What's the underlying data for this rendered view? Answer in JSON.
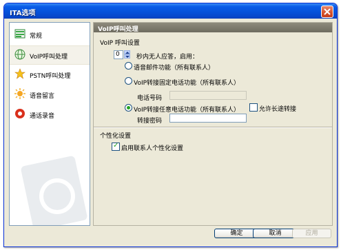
{
  "window": {
    "title": "ITA选项"
  },
  "sidebar": {
    "items": [
      {
        "label": "常规",
        "icon": "general-settings-icon",
        "selected": false
      },
      {
        "label": "VoIP呼叫处理",
        "icon": "voip-globe-icon",
        "selected": true
      },
      {
        "label": "PSTN呼叫处理",
        "icon": "pstn-star-icon",
        "selected": false
      },
      {
        "label": "语音留言",
        "icon": "voicemail-sun-icon",
        "selected": false
      },
      {
        "label": "通话录音",
        "icon": "record-icon",
        "selected": false
      }
    ]
  },
  "panel": {
    "header": "VoIP呼叫处理",
    "voip_section": {
      "title": "VoIP 呼叫设置",
      "seconds_value": "0",
      "seconds_text": "秒内无人应答，启用：",
      "option_voicemail": "语音邮件功能（所有联系人）",
      "option_fixed_transfer": "VoIP转接固定电话功能（所有联系人）",
      "phone_label": "电话号码",
      "phone_value": "",
      "option_any_transfer": "VoIP转接任意电话功能（所有联系人）",
      "long_distance_label": "允许长途转接",
      "password_label": "转接密码",
      "password_value": ""
    },
    "personal_section": {
      "title": "个性化设置",
      "enable_label": "启用联系人个性化设置"
    }
  },
  "buttons": {
    "ok": "确定",
    "cancel": "取消",
    "apply": "应用"
  },
  "colors": {
    "titlebar": "#0a5de8",
    "window_bg": "#ece9d8",
    "panel_header": "#7a776b"
  }
}
